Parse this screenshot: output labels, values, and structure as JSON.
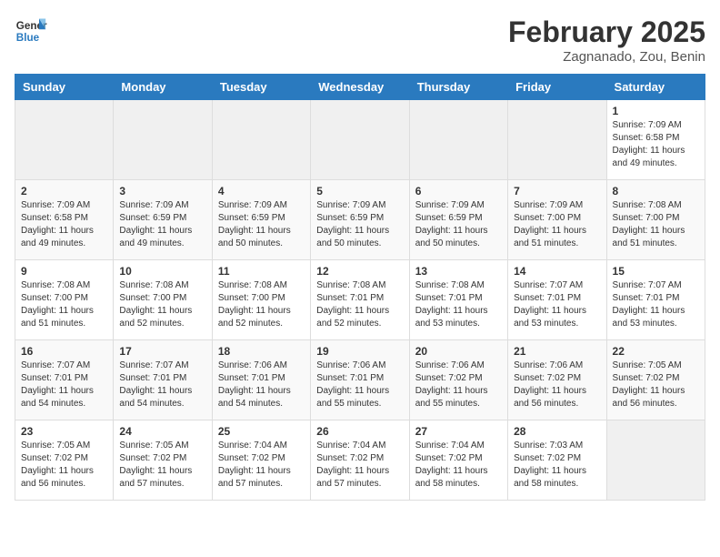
{
  "header": {
    "logo_general": "General",
    "logo_blue": "Blue",
    "month_title": "February 2025",
    "location": "Zagnanado, Zou, Benin"
  },
  "weekdays": [
    "Sunday",
    "Monday",
    "Tuesday",
    "Wednesday",
    "Thursday",
    "Friday",
    "Saturday"
  ],
  "weeks": [
    [
      {
        "day": "",
        "empty": true
      },
      {
        "day": "",
        "empty": true
      },
      {
        "day": "",
        "empty": true
      },
      {
        "day": "",
        "empty": true
      },
      {
        "day": "",
        "empty": true
      },
      {
        "day": "",
        "empty": true
      },
      {
        "day": "1",
        "sunrise": "7:09 AM",
        "sunset": "6:58 PM",
        "daylight": "11 hours and 49 minutes."
      }
    ],
    [
      {
        "day": "2",
        "sunrise": "7:09 AM",
        "sunset": "6:58 PM",
        "daylight": "11 hours and 49 minutes."
      },
      {
        "day": "3",
        "sunrise": "7:09 AM",
        "sunset": "6:59 PM",
        "daylight": "11 hours and 49 minutes."
      },
      {
        "day": "4",
        "sunrise": "7:09 AM",
        "sunset": "6:59 PM",
        "daylight": "11 hours and 50 minutes."
      },
      {
        "day": "5",
        "sunrise": "7:09 AM",
        "sunset": "6:59 PM",
        "daylight": "11 hours and 50 minutes."
      },
      {
        "day": "6",
        "sunrise": "7:09 AM",
        "sunset": "6:59 PM",
        "daylight": "11 hours and 50 minutes."
      },
      {
        "day": "7",
        "sunrise": "7:09 AM",
        "sunset": "7:00 PM",
        "daylight": "11 hours and 51 minutes."
      },
      {
        "day": "8",
        "sunrise": "7:08 AM",
        "sunset": "7:00 PM",
        "daylight": "11 hours and 51 minutes."
      }
    ],
    [
      {
        "day": "9",
        "sunrise": "7:08 AM",
        "sunset": "7:00 PM",
        "daylight": "11 hours and 51 minutes."
      },
      {
        "day": "10",
        "sunrise": "7:08 AM",
        "sunset": "7:00 PM",
        "daylight": "11 hours and 52 minutes."
      },
      {
        "day": "11",
        "sunrise": "7:08 AM",
        "sunset": "7:00 PM",
        "daylight": "11 hours and 52 minutes."
      },
      {
        "day": "12",
        "sunrise": "7:08 AM",
        "sunset": "7:01 PM",
        "daylight": "11 hours and 52 minutes."
      },
      {
        "day": "13",
        "sunrise": "7:08 AM",
        "sunset": "7:01 PM",
        "daylight": "11 hours and 53 minutes."
      },
      {
        "day": "14",
        "sunrise": "7:07 AM",
        "sunset": "7:01 PM",
        "daylight": "11 hours and 53 minutes."
      },
      {
        "day": "15",
        "sunrise": "7:07 AM",
        "sunset": "7:01 PM",
        "daylight": "11 hours and 53 minutes."
      }
    ],
    [
      {
        "day": "16",
        "sunrise": "7:07 AM",
        "sunset": "7:01 PM",
        "daylight": "11 hours and 54 minutes."
      },
      {
        "day": "17",
        "sunrise": "7:07 AM",
        "sunset": "7:01 PM",
        "daylight": "11 hours and 54 minutes."
      },
      {
        "day": "18",
        "sunrise": "7:06 AM",
        "sunset": "7:01 PM",
        "daylight": "11 hours and 54 minutes."
      },
      {
        "day": "19",
        "sunrise": "7:06 AM",
        "sunset": "7:01 PM",
        "daylight": "11 hours and 55 minutes."
      },
      {
        "day": "20",
        "sunrise": "7:06 AM",
        "sunset": "7:02 PM",
        "daylight": "11 hours and 55 minutes."
      },
      {
        "day": "21",
        "sunrise": "7:06 AM",
        "sunset": "7:02 PM",
        "daylight": "11 hours and 56 minutes."
      },
      {
        "day": "22",
        "sunrise": "7:05 AM",
        "sunset": "7:02 PM",
        "daylight": "11 hours and 56 minutes."
      }
    ],
    [
      {
        "day": "23",
        "sunrise": "7:05 AM",
        "sunset": "7:02 PM",
        "daylight": "11 hours and 56 minutes."
      },
      {
        "day": "24",
        "sunrise": "7:05 AM",
        "sunset": "7:02 PM",
        "daylight": "11 hours and 57 minutes."
      },
      {
        "day": "25",
        "sunrise": "7:04 AM",
        "sunset": "7:02 PM",
        "daylight": "11 hours and 57 minutes."
      },
      {
        "day": "26",
        "sunrise": "7:04 AM",
        "sunset": "7:02 PM",
        "daylight": "11 hours and 57 minutes."
      },
      {
        "day": "27",
        "sunrise": "7:04 AM",
        "sunset": "7:02 PM",
        "daylight": "11 hours and 58 minutes."
      },
      {
        "day": "28",
        "sunrise": "7:03 AM",
        "sunset": "7:02 PM",
        "daylight": "11 hours and 58 minutes."
      },
      {
        "day": "",
        "empty": true
      }
    ]
  ]
}
